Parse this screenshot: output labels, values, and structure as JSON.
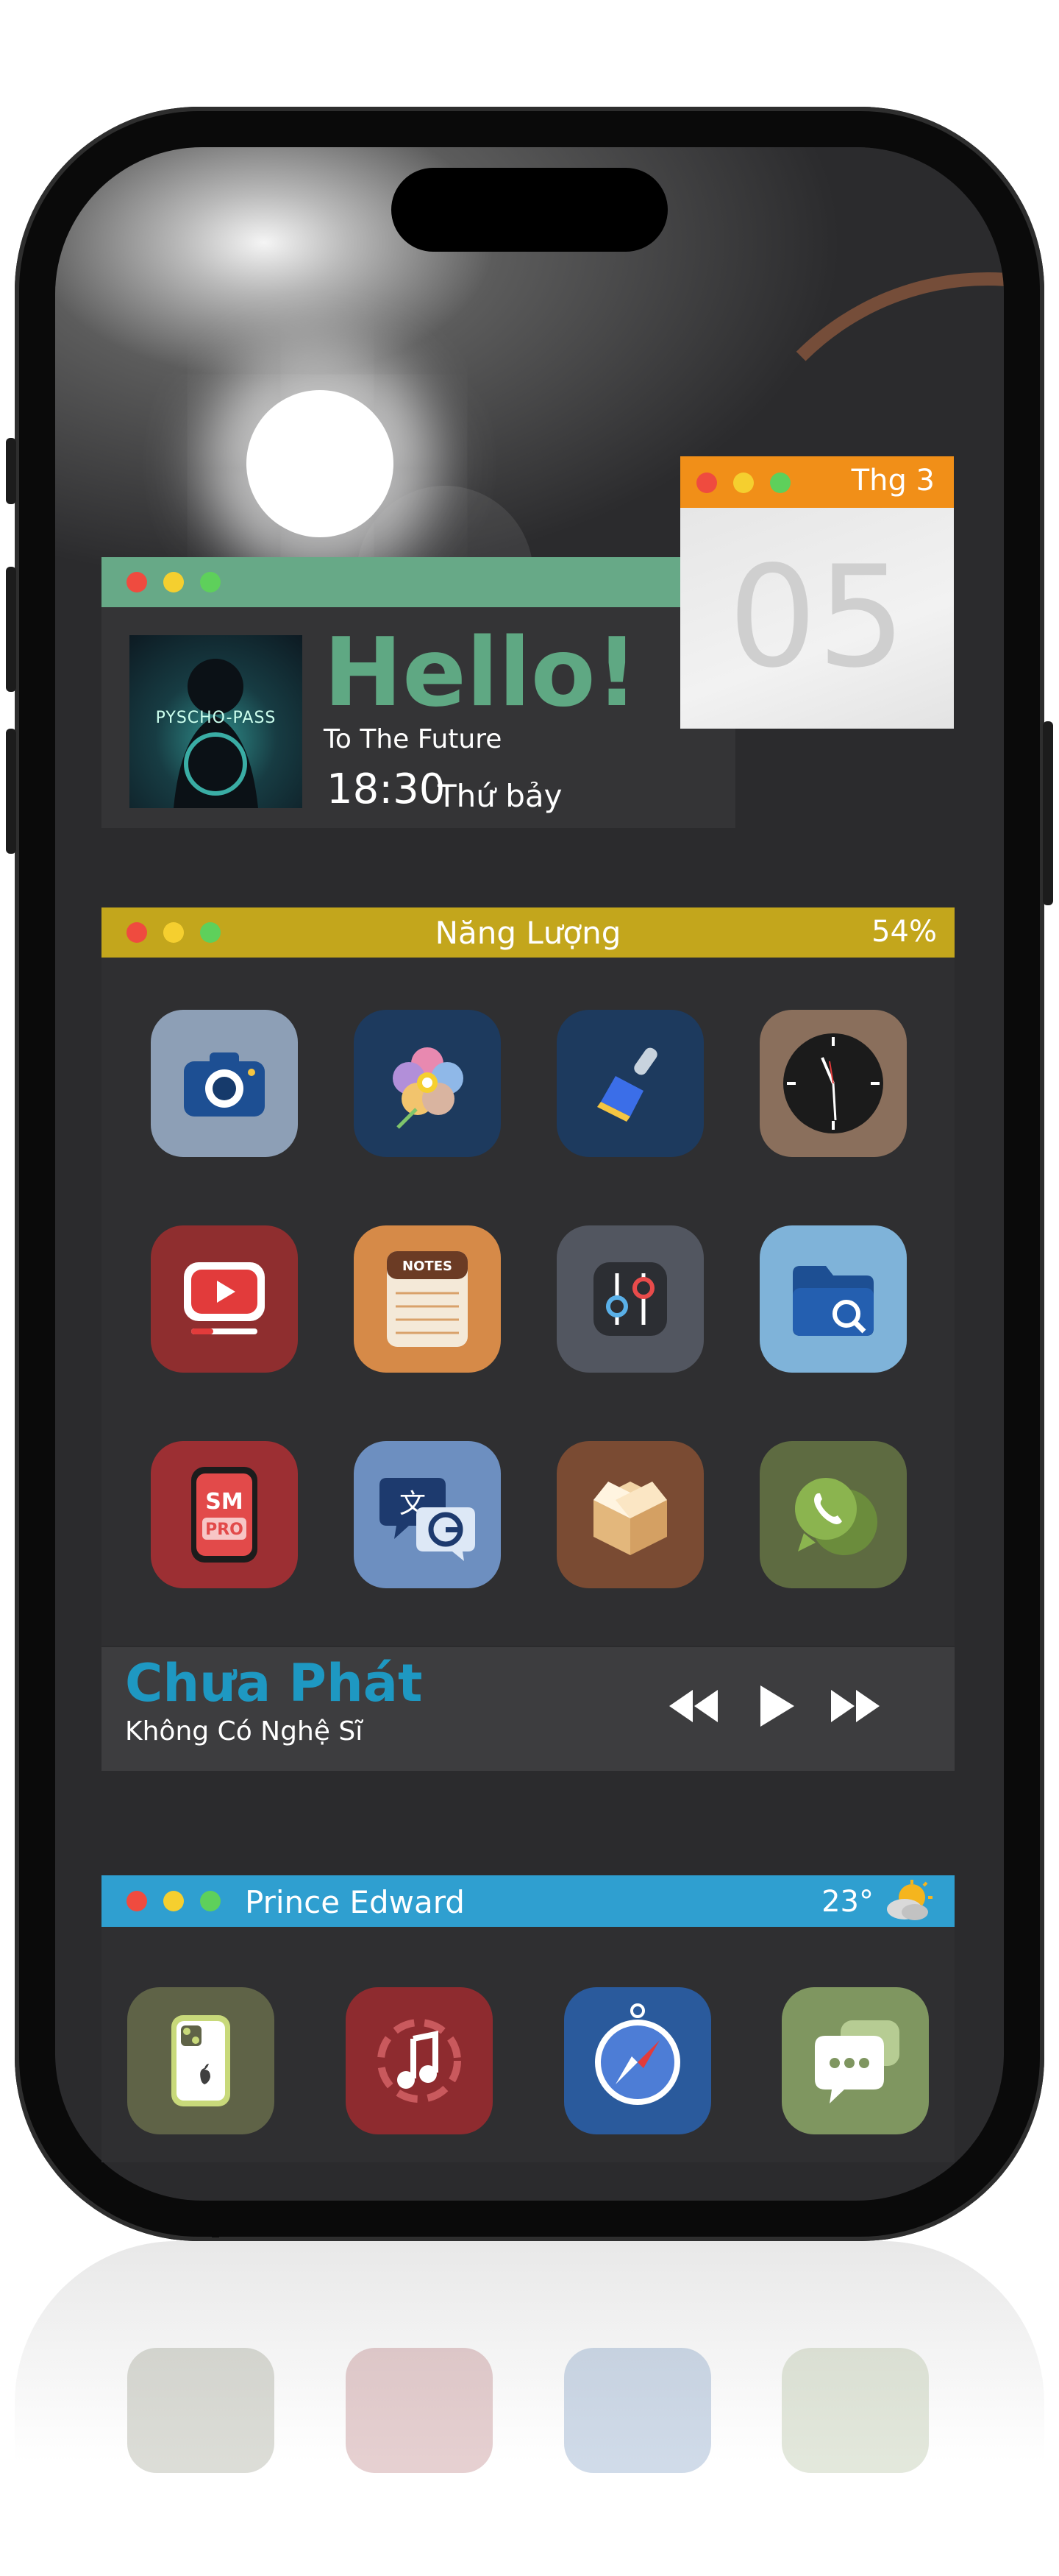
{
  "hello_widget": {
    "title": "Hello!",
    "subtitle": "To The Future",
    "time": "18:30",
    "day": "Thứ bảy",
    "album_text": "PYSCHO-PASS"
  },
  "calendar_widget": {
    "month": "Thg 3",
    "date": "05"
  },
  "energy_widget": {
    "title": "Năng Lượng",
    "percent": "54%"
  },
  "apps": [
    {
      "icon": "camera-icon",
      "color": "#8d9fb6"
    },
    {
      "icon": "photos-flower-icon",
      "color": "#1d3a5e"
    },
    {
      "icon": "cleaner-brush-icon",
      "color": "#1d3a5e"
    },
    {
      "icon": "clock-icon",
      "color": "#8a6f5c"
    },
    {
      "icon": "youtube-icon",
      "color": "#8f2e2f"
    },
    {
      "icon": "notes-icon",
      "color": "#d68a48"
    },
    {
      "icon": "settings-sliders-icon",
      "color": "#525660"
    },
    {
      "icon": "files-icon",
      "color": "#7fb3d9"
    },
    {
      "icon": "sm-pro-icon",
      "color": "#9c2f33"
    },
    {
      "icon": "translate-icon",
      "color": "#6d8fc0"
    },
    {
      "icon": "package-box-icon",
      "color": "#7a4b33"
    },
    {
      "icon": "whatsapp-icon",
      "color": "#5e6b41"
    }
  ],
  "app_texts": {
    "notes_label": "NOTES",
    "sm_label": "SM",
    "pro_label": "PRO"
  },
  "music": {
    "title": "Chưa Phát",
    "artist": "Không Có Nghệ Sĩ"
  },
  "weather_widget": {
    "city": "Prince Edward",
    "temp": "23°",
    "icon": "partly-cloudy-icon"
  },
  "dock_apps": [
    {
      "icon": "phone-find-icon",
      "color": "#5f6347"
    },
    {
      "icon": "music-icon",
      "color": "#8e2b2f"
    },
    {
      "icon": "safari-compass-icon",
      "color": "#2a5a9c"
    },
    {
      "icon": "messages-icon",
      "color": "#7f9660"
    }
  ],
  "colors": {
    "hello_accent": "#67a987",
    "calendar_accent": "#f18f18",
    "energy_accent": "#c3a61c",
    "weather_accent": "#2f9fd0",
    "music_title": "#1e98c2"
  }
}
